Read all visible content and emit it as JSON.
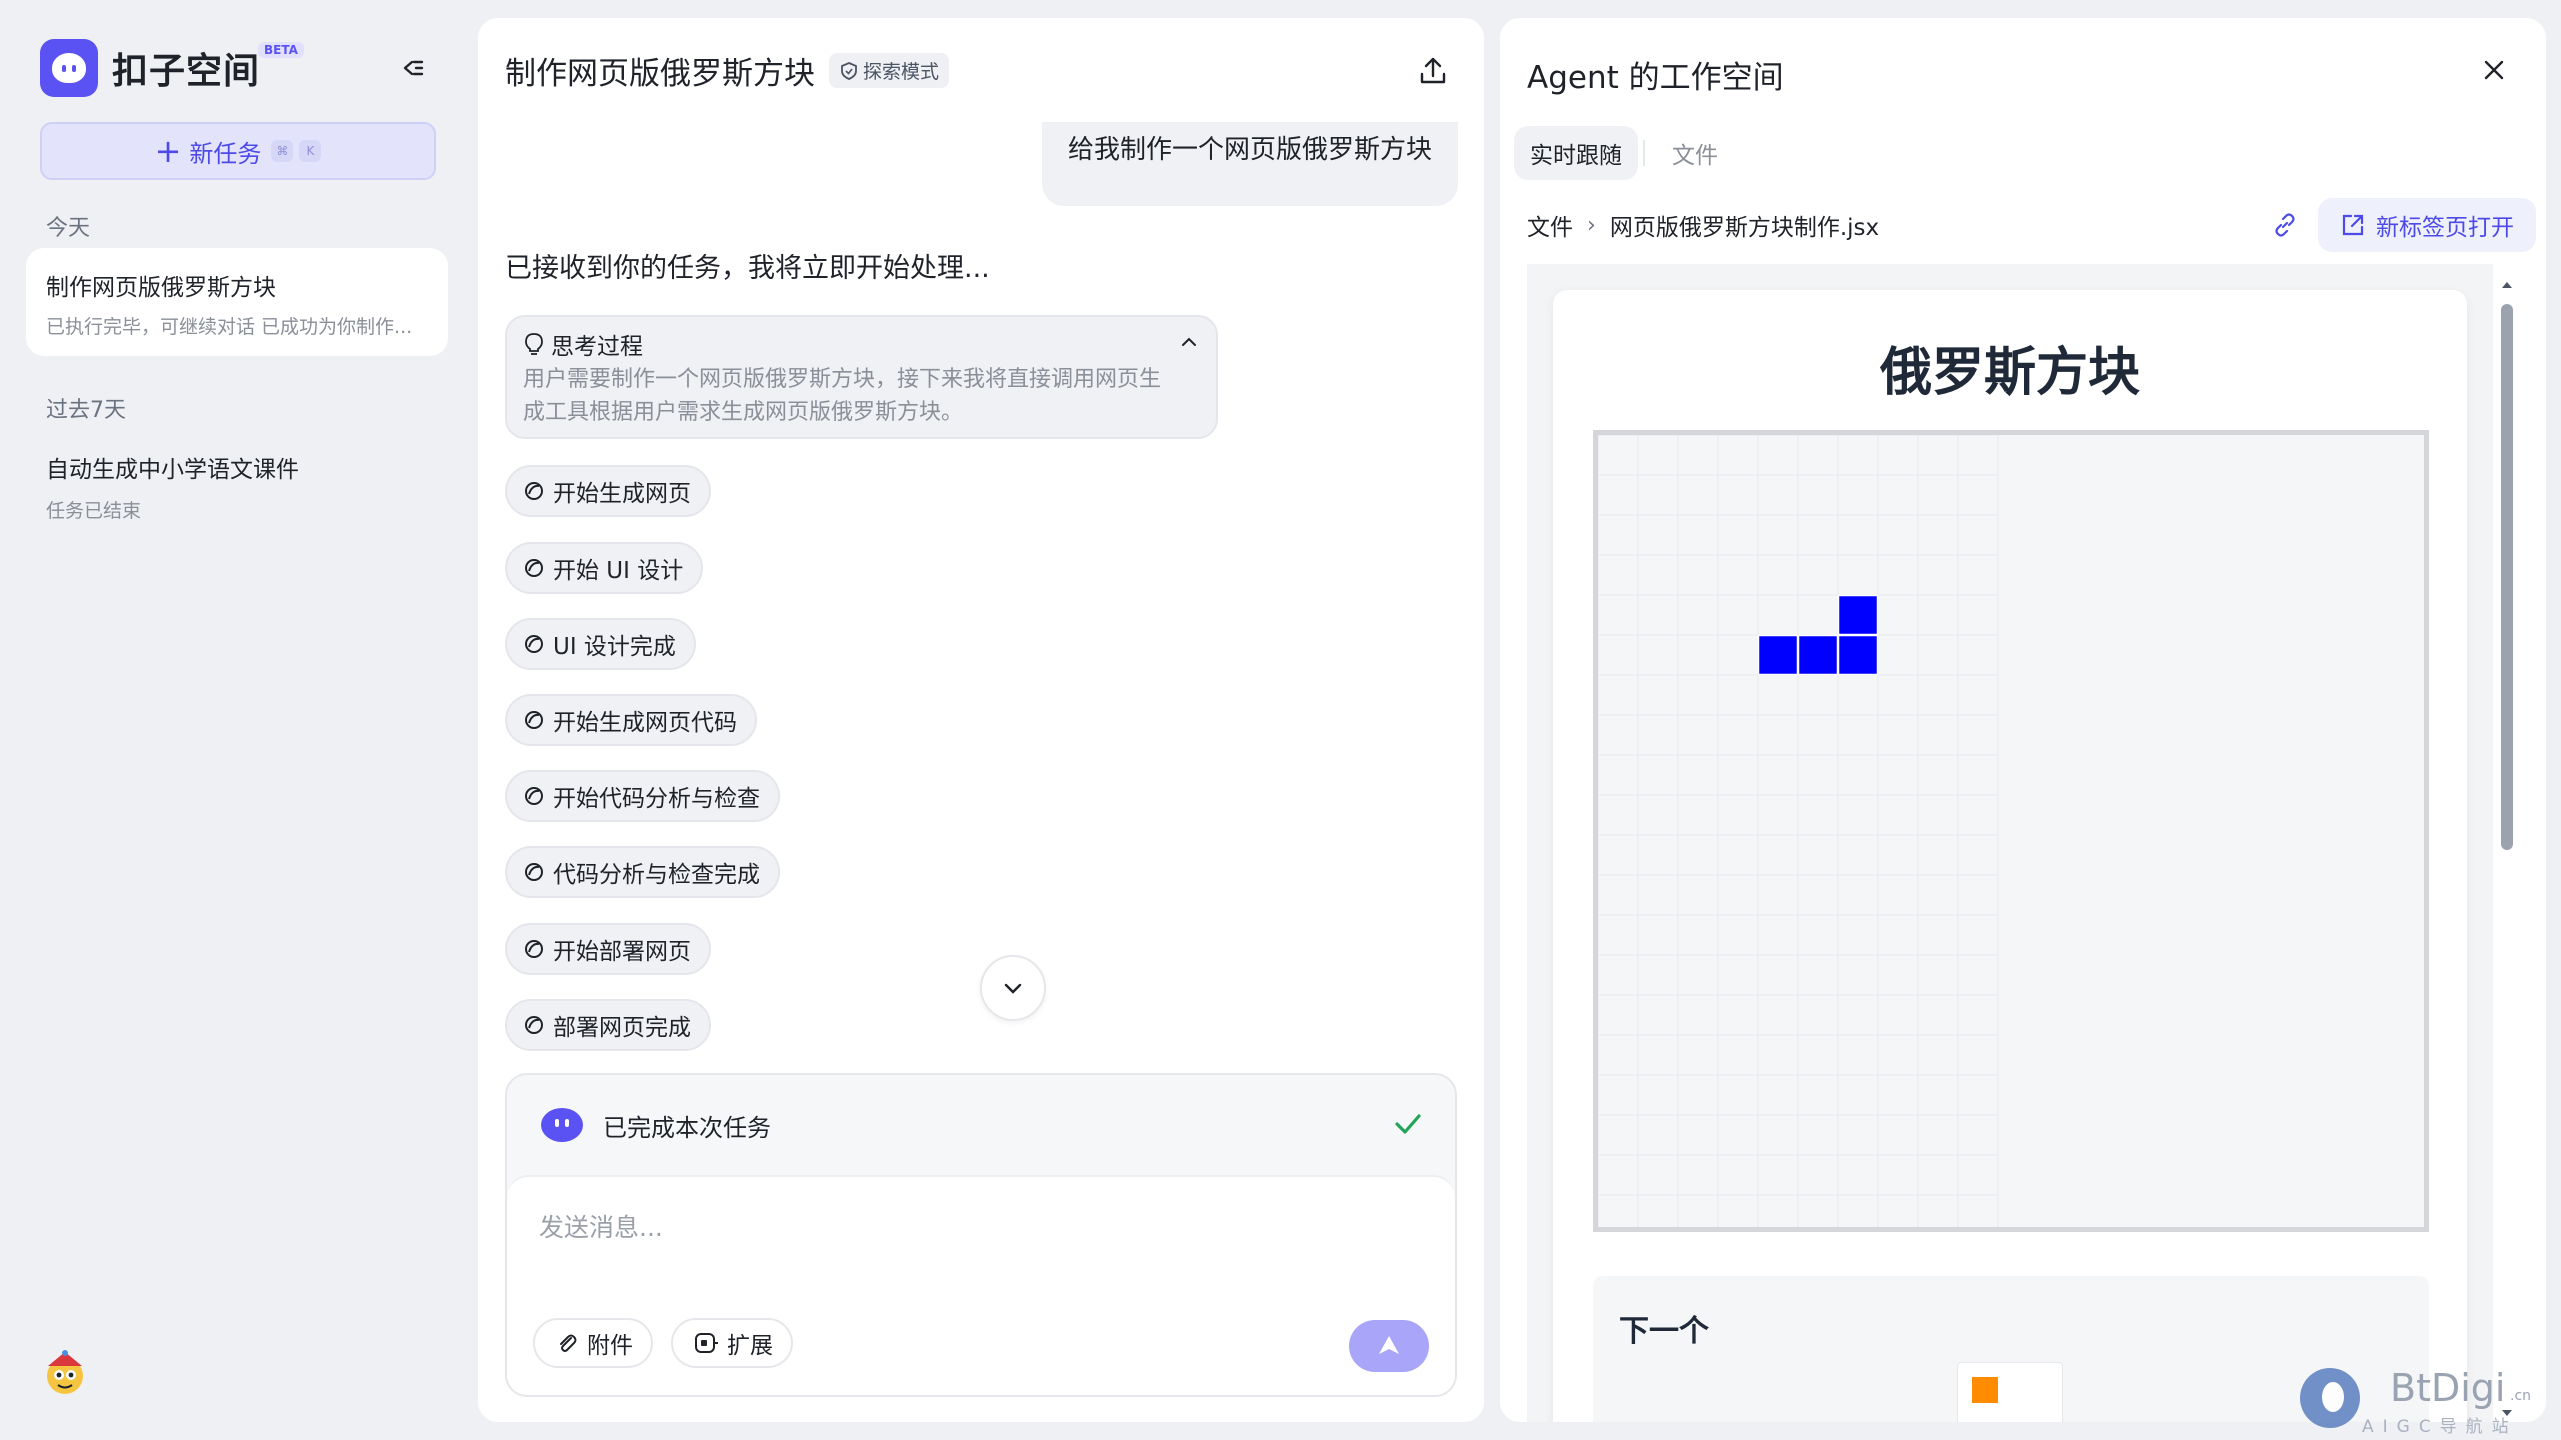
{
  "sidebar": {
    "logo_text": "扣子空间",
    "logo_badge": "BETA",
    "new_task_label": "新任务",
    "new_task_shortcut": [
      "⌘",
      "K"
    ],
    "section_today": "今天",
    "section_past7": "过去7天",
    "tasks_today": [
      {
        "title": "制作网页版俄罗斯方块",
        "subtitle": "已执行完毕，可继续对话 已成功为你制作..."
      }
    ],
    "tasks_past7": [
      {
        "title": "自动生成中小学语文课件",
        "subtitle": "任务已结束"
      }
    ]
  },
  "chat": {
    "title": "制作网页版俄罗斯方块",
    "mode_badge": "探索模式",
    "user_message": "给我制作一个网页版俄罗斯方块",
    "assistant_message": "已接收到你的任务，我将立即开始处理...",
    "thinking": {
      "title": "思考过程",
      "line1": "用户需要制作一个网页版俄罗斯方块，接下来我将直接调用网页生",
      "line2": "成工具根据用户需求生成网页版俄罗斯方块。"
    },
    "steps": [
      "开始生成网页",
      "开始 UI 设计",
      "UI 设计完成",
      "开始生成网页代码",
      "开始代码分析与检查",
      "代码分析与检查完成",
      "开始部署网页",
      "部署网页完成"
    ],
    "composer": {
      "status_text": "已完成本次任务",
      "placeholder": "发送消息...",
      "attach_label": "附件",
      "extend_label": "扩展"
    }
  },
  "workspace": {
    "title": "Agent 的工作空间",
    "tabs": [
      {
        "label": "实时跟随",
        "active": true
      },
      {
        "label": "文件",
        "active": false
      }
    ],
    "breadcrumb_root": "文件",
    "breadcrumb_file": "网页版俄罗斯方块制作.jsx",
    "open_new_tab_label": "新标签页打开",
    "preview": {
      "game_title": "俄罗斯方块",
      "next_label": "下一个",
      "grid_columns": 10,
      "grid_rows": 20,
      "active_piece_color": "#0000ff",
      "next_piece_color": "#ff8c00",
      "active_piece_cells": [
        [
          6,
          4
        ],
        [
          4,
          5
        ],
        [
          5,
          5
        ],
        [
          6,
          5
        ]
      ]
    }
  },
  "watermark": {
    "brand": "BtDigi",
    "domain_suffix": ".cn",
    "subtitle": "AIGC导航站"
  },
  "colors": {
    "accent": "#5b52f3",
    "accent_text": "#4d4ae8",
    "success": "#22a559"
  }
}
